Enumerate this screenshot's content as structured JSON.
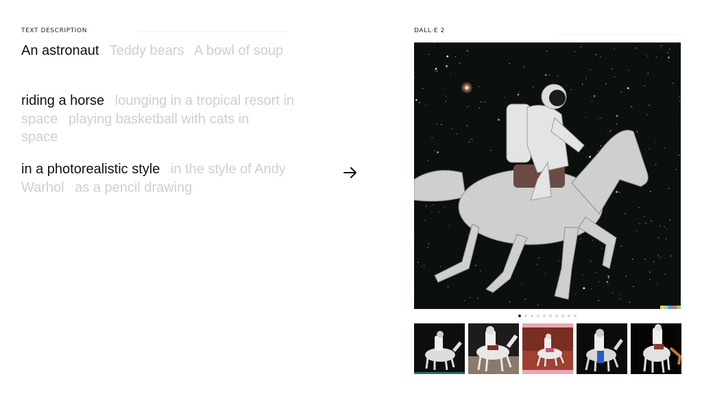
{
  "left_panel": {
    "label": "TEXT DESCRIPTION",
    "blocks": [
      {
        "options": [
          "An astronaut",
          "Teddy bears",
          "A bowl of soup"
        ],
        "selected": 0
      },
      {
        "options": [
          "riding a horse",
          "lounging in a tropical resort in space",
          "playing basketball with cats in space"
        ],
        "selected": 0
      },
      {
        "options": [
          "in a photorealistic style",
          "in the style of Andy Warhol",
          "as a pencil drawing"
        ],
        "selected": 0
      }
    ]
  },
  "right_panel": {
    "label": "DALL·E 2",
    "pager": {
      "count": 10,
      "active": 0
    },
    "thumbnails": [
      {
        "name": "astronaut-horse-black-bg"
      },
      {
        "name": "astronaut-horse-desert"
      },
      {
        "name": "astronaut-horse-red-landscape"
      },
      {
        "name": "astronaut-horse-dark-bg"
      },
      {
        "name": "astronaut-horse-black-bg-2"
      }
    ]
  },
  "colors": {
    "selected_text": "#111111",
    "faded_text": "#cfcfcf",
    "space_bg": "#0b100d",
    "strip": [
      "#f2d14a",
      "#7ad4c8",
      "#5a8ee0",
      "#e06a6a",
      "#8bd46a"
    ]
  }
}
